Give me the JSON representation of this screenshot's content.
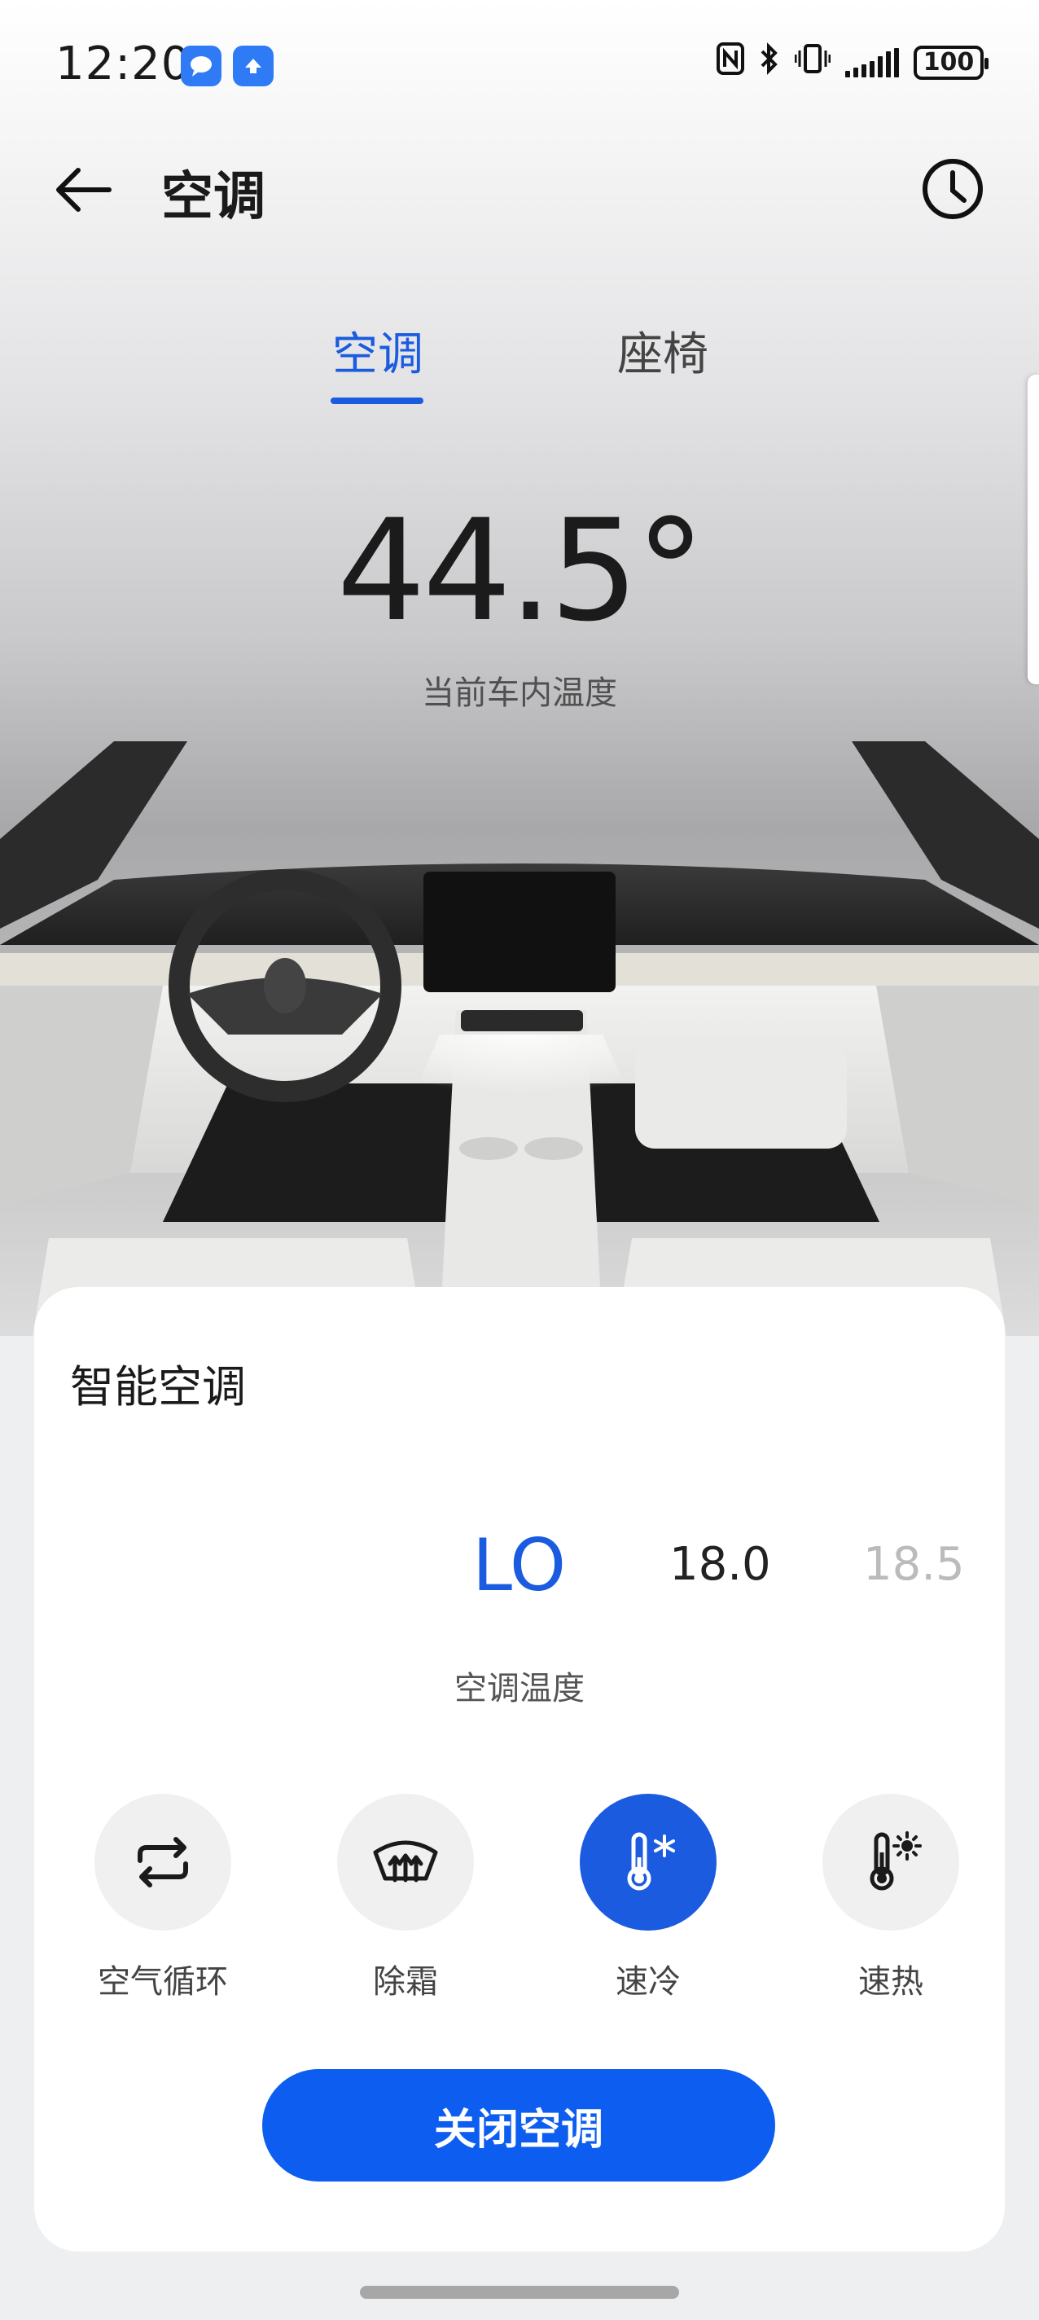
{
  "status_bar": {
    "time": "12:20",
    "notification_icons": [
      "message-icon",
      "upload-icon"
    ],
    "battery": "100",
    "system_icons": [
      "nfc-icon",
      "bluetooth-icon",
      "vibrate-icon",
      "signal-icon",
      "battery-icon"
    ]
  },
  "header": {
    "title": "空调"
  },
  "tabs": [
    {
      "label": "空调",
      "active": true
    },
    {
      "label": "座椅",
      "active": false
    }
  ],
  "cabin": {
    "temperature": "44.5°",
    "label": "当前车内温度"
  },
  "card": {
    "title": "智能空调",
    "temperature_options": [
      "LO",
      "18.0",
      "18.5"
    ],
    "selected_temperature": "LO",
    "temperature_label": "空调温度",
    "functions": [
      {
        "label": "空气循环",
        "icon": "air-recirculation-icon",
        "active": false
      },
      {
        "label": "除霜",
        "icon": "defrost-icon",
        "active": false
      },
      {
        "label": "速冷",
        "icon": "quick-cool-icon",
        "active": true
      },
      {
        "label": "速热",
        "icon": "quick-heat-icon",
        "active": false
      }
    ],
    "close_button": "关闭空调"
  },
  "colors": {
    "accent": "#1a5be0",
    "button": "#0d5ef0"
  }
}
